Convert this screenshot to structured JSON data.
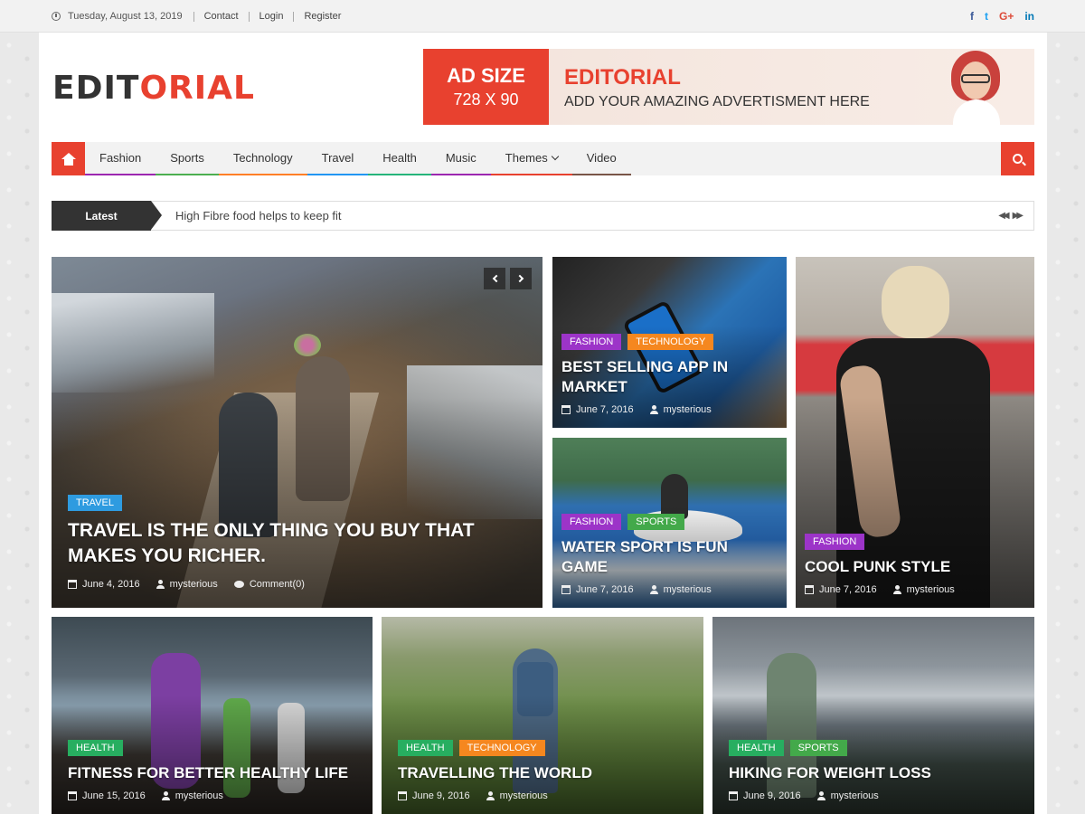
{
  "topbar": {
    "date": "Tuesday, August 13, 2019",
    "links": [
      "Contact",
      "Login",
      "Register"
    ],
    "social": [
      "f",
      "t",
      "G+",
      "in"
    ]
  },
  "logo": {
    "part1": "EDIT",
    "part2": "ORIAL"
  },
  "ad": {
    "size": "AD SIZE",
    "dims": "728 X 90",
    "title": "EDITORIAL",
    "subtitle": "ADD YOUR AMAZING ADVERTISMENT HERE"
  },
  "nav": {
    "items": [
      {
        "label": "Fashion",
        "color": "#9c27b0"
      },
      {
        "label": "Sports",
        "color": "#4caf50"
      },
      {
        "label": "Technology",
        "color": "#ff7f27"
      },
      {
        "label": "Travel",
        "color": "#2196f3"
      },
      {
        "label": "Health",
        "color": "#26b47a"
      },
      {
        "label": "Music",
        "color": "#9c27b0"
      },
      {
        "label": "Themes",
        "color": "#e8412f"
      },
      {
        "label": "Video",
        "color": "#795548"
      }
    ]
  },
  "ticker": {
    "label": "Latest",
    "text": "High Fibre food helps to keep fit"
  },
  "colors": {
    "accent": "#e8412f",
    "fashion": "#9c34c8",
    "technology": "#f5871f",
    "sports": "#43a94a",
    "health": "#27ae60",
    "travel": "#2e9be0"
  },
  "posts": {
    "travel": {
      "cats": [
        "TRAVEL"
      ],
      "title": "TRAVEL IS THE ONLY THING YOU BUY THAT MAKES YOU RICHER.",
      "date": "June 4, 2016",
      "author": "mysterious",
      "comments": "Comment(0)"
    },
    "app": {
      "cats": [
        "FASHION",
        "TECHNOLOGY"
      ],
      "title": "BEST SELLING APP IN MARKET",
      "date": "June 7, 2016",
      "author": "mysterious"
    },
    "water": {
      "cats": [
        "FASHION",
        "SPORTS"
      ],
      "title": "WATER SPORT IS FUN GAME",
      "date": "June 7, 2016",
      "author": "mysterious"
    },
    "punk": {
      "cats": [
        "FASHION"
      ],
      "title": "COOL PUNK STYLE",
      "date": "June 7, 2016",
      "author": "mysterious"
    },
    "fitness": {
      "cats": [
        "HEALTH"
      ],
      "title": "FITNESS FOR BETTER HEALTHY LIFE",
      "date": "June 15, 2016",
      "author": "mysterious"
    },
    "world": {
      "cats": [
        "HEALTH",
        "TECHNOLOGY"
      ],
      "title": "TRAVELLING THE WORLD",
      "date": "June 9, 2016",
      "author": "mysterious"
    },
    "hiking": {
      "cats": [
        "HEALTH",
        "SPORTS"
      ],
      "title": "HIKING FOR WEIGHT LOSS",
      "date": "June 9, 2016",
      "author": "mysterious"
    }
  }
}
